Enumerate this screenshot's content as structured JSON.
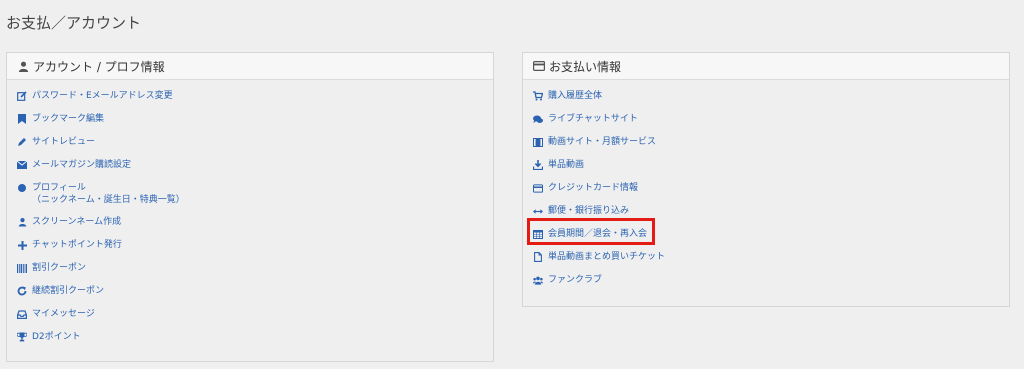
{
  "page": {
    "title": "お支払／アカウント"
  },
  "left_panel": {
    "title": "アカウント / プロフ情報",
    "icon": "user-icon",
    "items": [
      {
        "label": "パスワード・Eメールアドレス変更",
        "icon": "edit-icon"
      },
      {
        "label": "ブックマーク編集",
        "icon": "bookmark-icon"
      },
      {
        "label": "サイトレビュー",
        "icon": "pencil-icon"
      },
      {
        "label": "メールマガジン購読設定",
        "icon": "envelope-icon"
      },
      {
        "label": "プロフィール\n（ニックネーム・誕生日・特典一覧）",
        "icon": "circle-icon"
      },
      {
        "label": "スクリーンネーム作成",
        "icon": "user-icon"
      },
      {
        "label": "チャットポイント発行",
        "icon": "plus-icon"
      },
      {
        "label": "割引クーポン",
        "icon": "barcode-icon"
      },
      {
        "label": "継続割引クーポン",
        "icon": "refresh-icon"
      },
      {
        "label": "マイメッセージ",
        "icon": "inbox-icon"
      },
      {
        "label": "D2ポイント",
        "icon": "trophy-icon"
      }
    ]
  },
  "right_panel": {
    "title": "お支払い情報",
    "icon": "credit-card-icon",
    "items": [
      {
        "label": "購入履歴全体",
        "icon": "cart-icon"
      },
      {
        "label": "ライブチャットサイト",
        "icon": "comments-icon"
      },
      {
        "label": "動画サイト・月額サービス",
        "icon": "film-icon"
      },
      {
        "label": "単品動画",
        "icon": "download-icon"
      },
      {
        "label": "クレジットカード情報",
        "icon": "credit-card-icon"
      },
      {
        "label": "郵便・銀行振り込み",
        "icon": "arrows-h-icon"
      },
      {
        "label": "会員期間／退会・再入会",
        "icon": "calendar-icon"
      },
      {
        "label": "単品動画まとめ買いチケット",
        "icon": "file-icon"
      },
      {
        "label": "ファンクラブ",
        "icon": "users-icon"
      }
    ]
  },
  "colors": {
    "link": "#2b63b2",
    "highlight": "#e31b12",
    "background": "#efefef"
  }
}
